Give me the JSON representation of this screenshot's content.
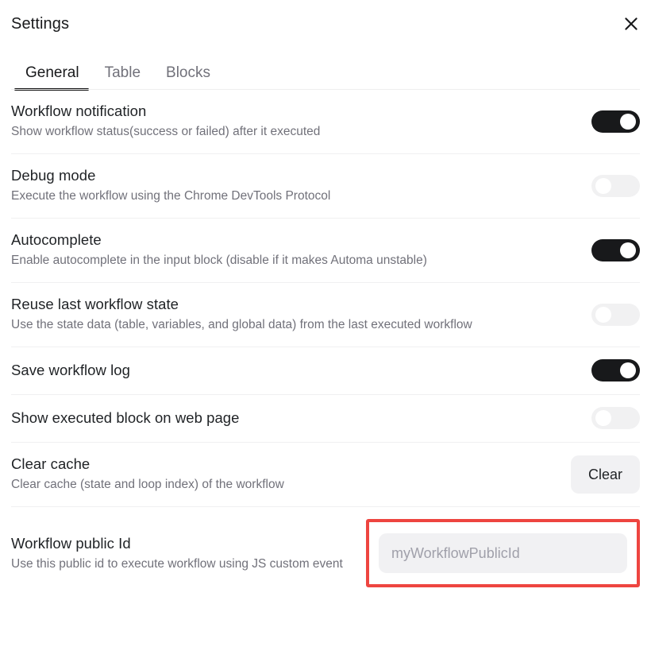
{
  "header": {
    "title": "Settings",
    "close_icon": "close-icon"
  },
  "tabs": [
    {
      "label": "General",
      "active": true
    },
    {
      "label": "Table",
      "active": false
    },
    {
      "label": "Blocks",
      "active": false
    }
  ],
  "settings": [
    {
      "key": "workflow-notification",
      "title": "Workflow notification",
      "description": "Show workflow status(success or failed) after it executed",
      "control": "toggle",
      "value": "on"
    },
    {
      "key": "debug-mode",
      "title": "Debug mode",
      "description": "Execute the workflow using the Chrome DevTools Protocol",
      "control": "toggle",
      "value": "off"
    },
    {
      "key": "autocomplete",
      "title": "Autocomplete",
      "description": "Enable autocomplete in the input block (disable if it makes Automa unstable)",
      "control": "toggle",
      "value": "on"
    },
    {
      "key": "reuse-last-workflow-state",
      "title": "Reuse last workflow state",
      "description": "Use the state data (table, variables, and global data) from the last executed workflow",
      "control": "toggle",
      "value": "off"
    },
    {
      "key": "save-workflow-log",
      "title": "Save workflow log",
      "description": "",
      "control": "toggle",
      "value": "on"
    },
    {
      "key": "show-executed-block",
      "title": "Show executed block on web page",
      "description": "",
      "control": "toggle",
      "value": "off"
    },
    {
      "key": "clear-cache",
      "title": "Clear cache",
      "description": "Clear cache (state and loop index) of the workflow",
      "control": "button",
      "button_label": "Clear"
    },
    {
      "key": "workflow-public-id",
      "title": "Workflow public Id",
      "description": "Use this public id to execute workflow using JS custom event",
      "control": "input",
      "input_placeholder": "myWorkflowPublicId",
      "input_value": "",
      "highlighted": true
    }
  ],
  "colors": {
    "highlight_border": "#ee4540",
    "toggle_on": "#18191b",
    "toggle_off": "#f1f1f2",
    "title_text": "#1f2225",
    "description_text": "#71717a",
    "input_background": "#f1f1f3"
  }
}
